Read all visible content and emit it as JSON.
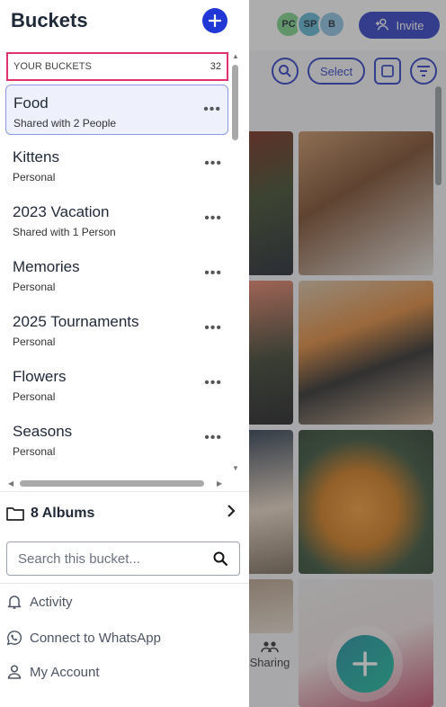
{
  "header": {
    "title": "Buckets",
    "add_icon": "plus-icon",
    "invite_label": "Invite",
    "avatars": [
      {
        "initials": "PC",
        "color": "#7fd48a"
      },
      {
        "initials": "SP",
        "color": "#5fb8d6"
      },
      {
        "initials": "B",
        "color": "#8ec3e6"
      }
    ]
  },
  "toolbar": {
    "select_label": "Select"
  },
  "buckets_section": {
    "label": "YOUR BUCKETS",
    "count": "32"
  },
  "buckets": [
    {
      "name": "Food",
      "subtitle": "Shared with 2 People",
      "selected": true
    },
    {
      "name": "Kittens",
      "subtitle": "Personal"
    },
    {
      "name": "2023 Vacation",
      "subtitle": "Shared with 1 Person"
    },
    {
      "name": "Memories",
      "subtitle": "Personal"
    },
    {
      "name": "2025 Tournaments",
      "subtitle": "Personal"
    },
    {
      "name": "Flowers",
      "subtitle": "Personal"
    },
    {
      "name": "Seasons",
      "subtitle": "Personal"
    }
  ],
  "albums": {
    "label": "8 Albums"
  },
  "search": {
    "placeholder": "Search this bucket..."
  },
  "menu": {
    "activity": "Activity",
    "whatsapp": "Connect to WhatsApp",
    "account": "My Account"
  },
  "bottom_nav": {
    "sharing": "Sharing"
  },
  "colors": {
    "accent": "#2238d6",
    "highlight_border": "#e0336b",
    "selected_bg": "#eef0fb"
  }
}
